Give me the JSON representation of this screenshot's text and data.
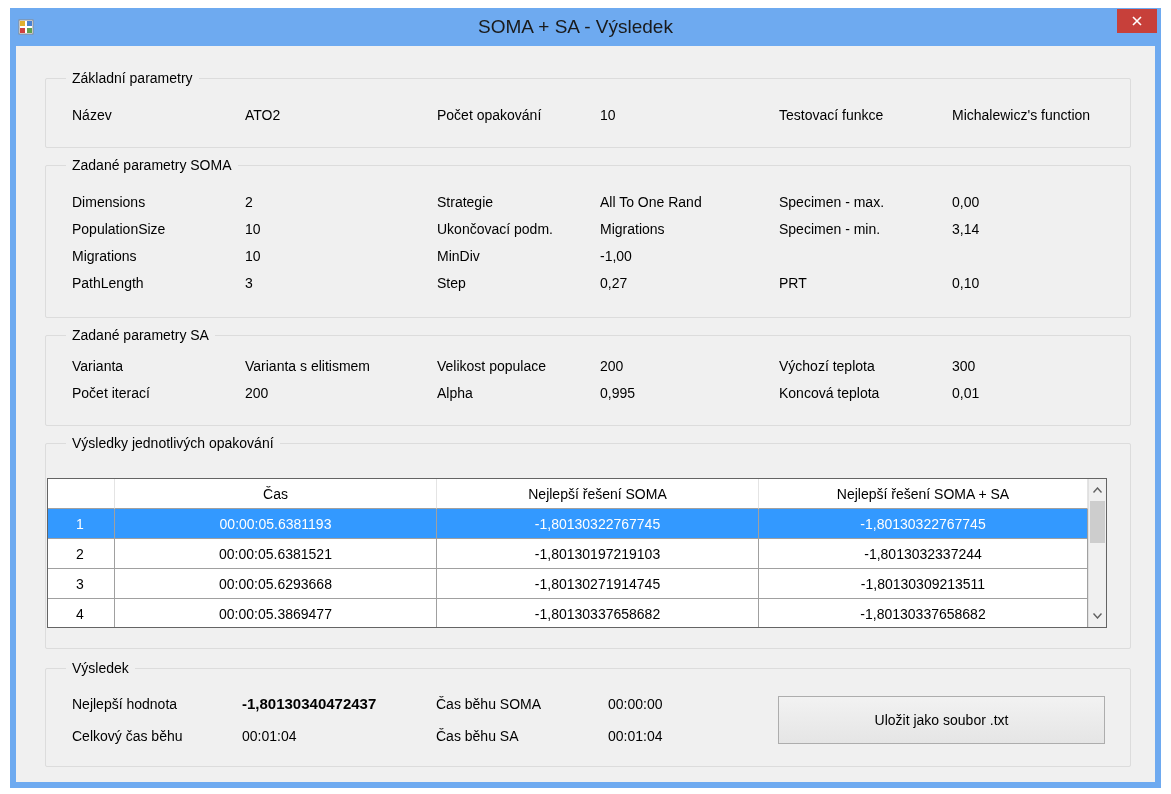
{
  "window": {
    "title": "SOMA + SA - Výsledek"
  },
  "basic": {
    "title": "Základní parametry",
    "rows": [
      [
        {
          "label": "Název",
          "value": "ATO2"
        },
        {
          "label": "Počet opakování",
          "value": "10"
        },
        {
          "label": "Testovací funkce",
          "value": "Michalewicz's function"
        }
      ]
    ]
  },
  "soma": {
    "title": "Zadané parametry SOMA",
    "rows": [
      [
        {
          "label": "Dimensions",
          "value": "2"
        },
        {
          "label": "Strategie",
          "value": "All To One Rand"
        },
        {
          "label": "Specimen - max.",
          "value": "0,00"
        }
      ],
      [
        {
          "label": "PopulationSize",
          "value": "10"
        },
        {
          "label": "Ukončovací podm.",
          "value": "Migrations"
        },
        {
          "label": "Specimen - min.",
          "value": "3,14"
        }
      ],
      [
        {
          "label": "Migrations",
          "value": "10"
        },
        {
          "label": "MinDiv",
          "value": "-1,00"
        }
      ],
      [
        {
          "label": "PathLength",
          "value": "3"
        },
        {
          "label": "Step",
          "value": "0,27"
        },
        {
          "label": "PRT",
          "value": "0,10"
        }
      ]
    ]
  },
  "sa": {
    "title": "Zadané parametry SA",
    "rows": [
      [
        {
          "label": "Varianta",
          "value": "Varianta s elitismem"
        },
        {
          "label": "Velikost populace",
          "value": "200"
        },
        {
          "label": "Výchozí teplota",
          "value": "300"
        }
      ],
      [
        {
          "label": "Počet iterací",
          "value": "200"
        },
        {
          "label": "Alpha",
          "value": "0,995"
        },
        {
          "label": "Koncová teplota",
          "value": "0,01"
        }
      ]
    ]
  },
  "runs": {
    "title": "Výsledky jednotlivých opakování",
    "columns": [
      "Čas",
      "Nejlepší řešení SOMA",
      "Nejlepší řešení SOMA + SA"
    ],
    "rows": [
      {
        "index": "1",
        "selected": true,
        "cells": [
          "00:00:05.6381193",
          "-1,80130322767745",
          "-1,80130322767745"
        ]
      },
      {
        "index": "2",
        "selected": false,
        "cells": [
          "00:00:05.6381521",
          "-1,80130197219103",
          "-1,8013032337244"
        ]
      },
      {
        "index": "3",
        "selected": false,
        "cells": [
          "00:00:05.6293668",
          "-1,80130271914745",
          "-1,80130309213511"
        ]
      },
      {
        "index": "4",
        "selected": false,
        "cells": [
          "00:00:05.3869477",
          "-1,80130337658682",
          "-1,80130337658682"
        ]
      }
    ]
  },
  "result": {
    "title": "Výsledek",
    "rows": [
      [
        {
          "label": "Nejlepší hodnota",
          "value": "-1,80130340472437",
          "kind": "bold"
        },
        {
          "label": "Čas běhu SOMA",
          "value": "00:00:00",
          "kind": "plain"
        }
      ],
      [
        {
          "label": "Celkový čas běhu",
          "value": "00:01:04",
          "kind": "plain"
        },
        {
          "label": "Čas běhu SA",
          "value": "00:01:04",
          "kind": "plain"
        }
      ]
    ],
    "button": "Uložit jako soubor .txt"
  }
}
